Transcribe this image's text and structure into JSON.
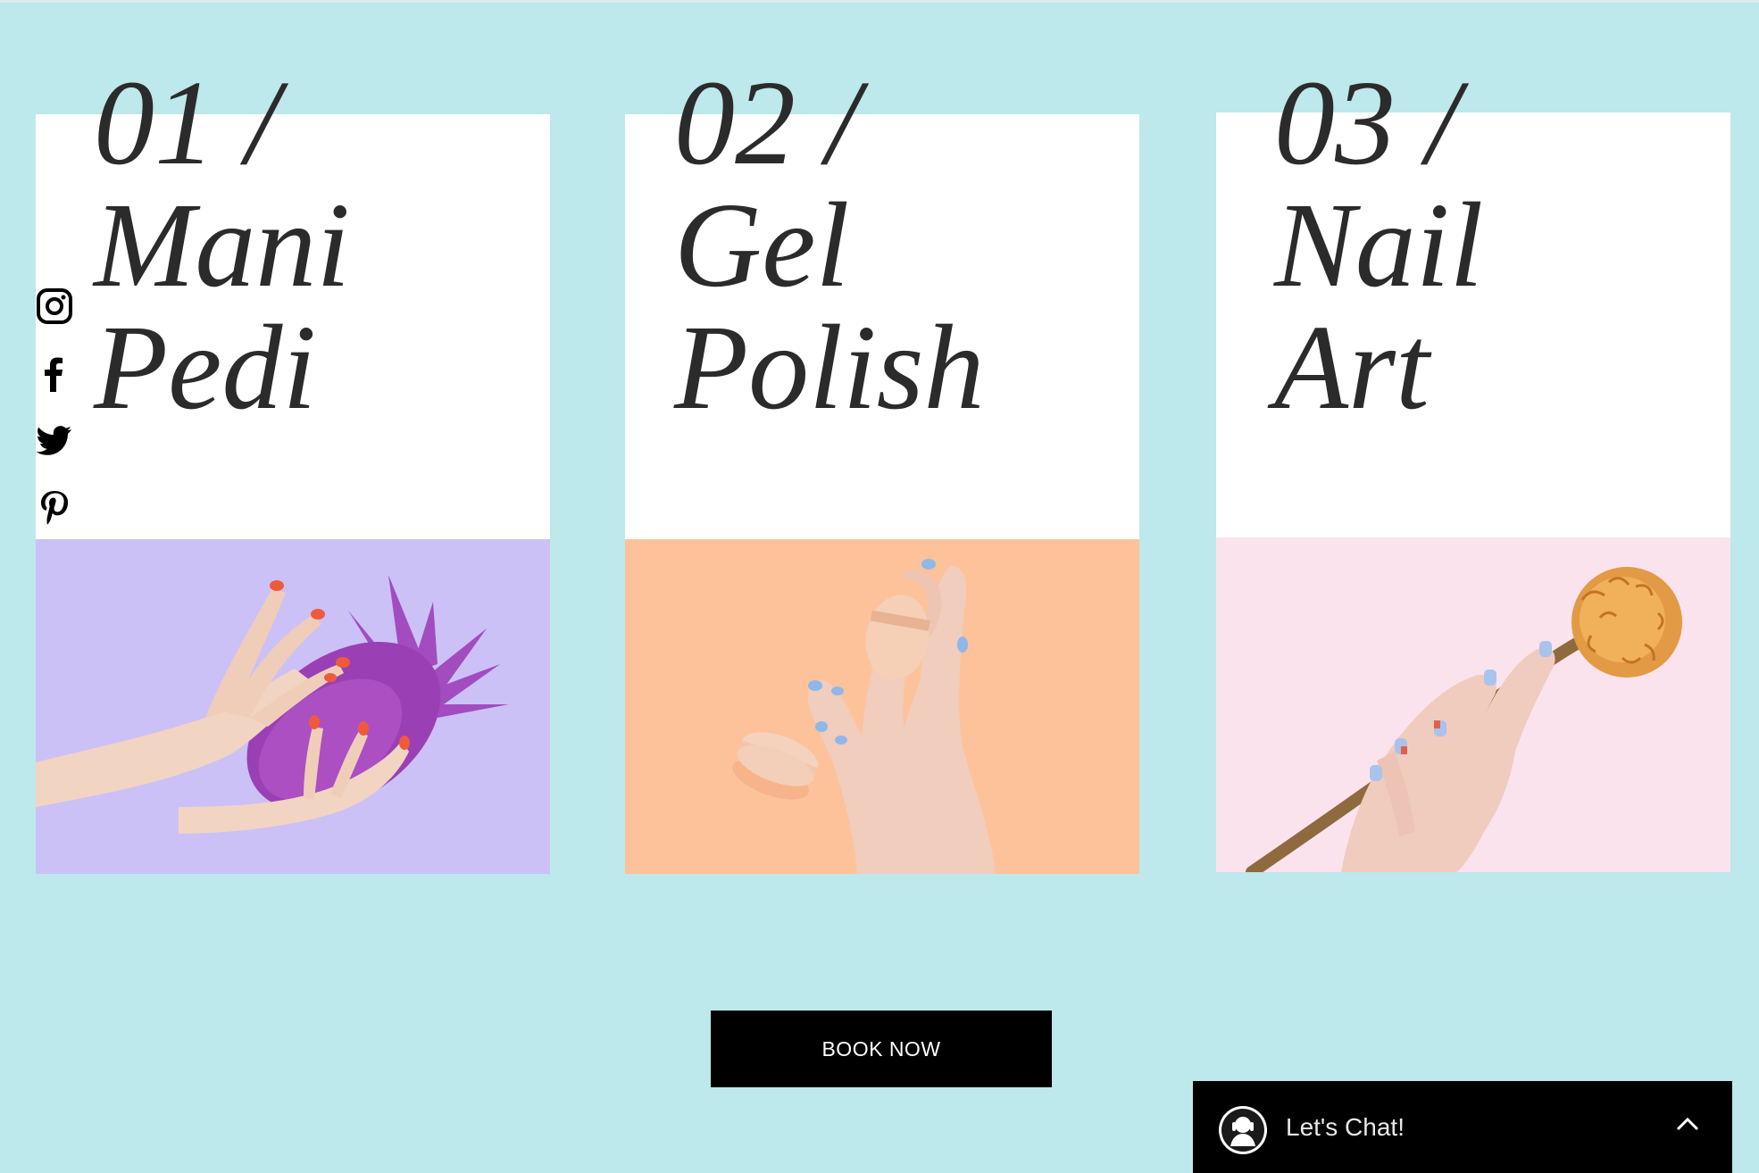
{
  "social": {
    "icons": [
      "instagram-icon",
      "facebook-icon",
      "twitter-icon",
      "pinterest-icon"
    ]
  },
  "services": [
    {
      "number": "01 /",
      "line1": "Mani",
      "line2": "Pedi",
      "photo_bg": "#cbc1f7",
      "photo_subject": "hands holding a purple pineapple"
    },
    {
      "number": "02 /",
      "line1": "Gel",
      "line2": "Polish",
      "photo_bg": "#fdc29a",
      "photo_subject": "hand holding a macaron"
    },
    {
      "number": "03 /",
      "line1": "Nail",
      "line2": "Art",
      "photo_bg": "#fbe3ee",
      "photo_subject": "hand holding an orange flower"
    }
  ],
  "cta": {
    "label": "BOOK NOW"
  },
  "chat": {
    "label": "Let's Chat!"
  },
  "colors": {
    "page_bg": "#bde8ec",
    "card_bg": "#ffffff",
    "title": "#2b2b2b",
    "button_bg": "#000000"
  }
}
